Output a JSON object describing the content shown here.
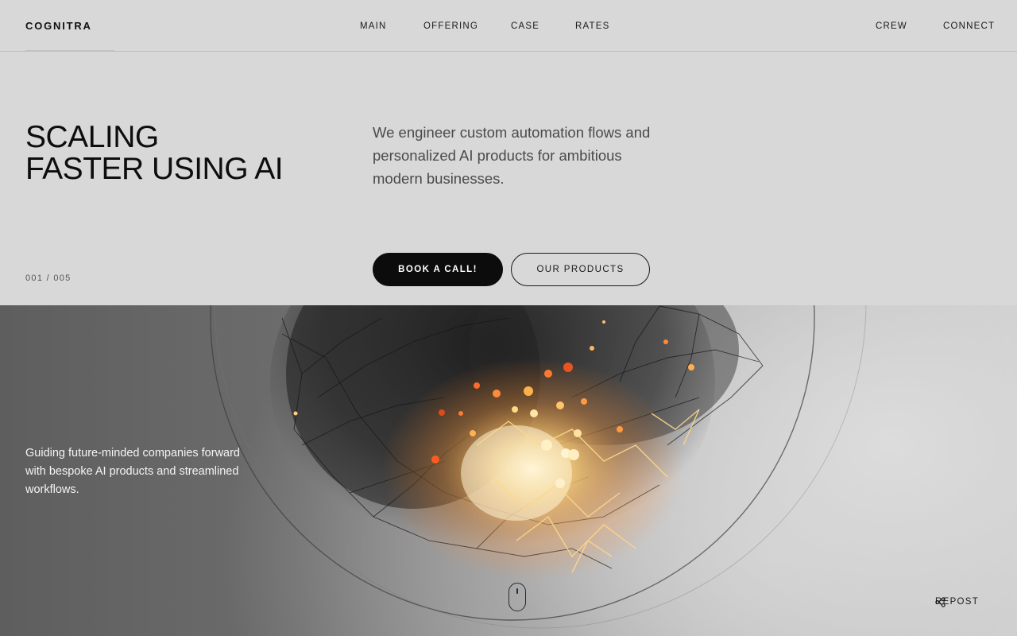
{
  "brand": {
    "name": "COGNITRA"
  },
  "nav": {
    "links": [
      {
        "label": "MAIN"
      },
      {
        "label": "OFFERING"
      },
      {
        "label": "CASE"
      },
      {
        "label": "RATES"
      },
      {
        "label": "CREW"
      },
      {
        "label": "CONNECT"
      }
    ]
  },
  "hero": {
    "headline_line1": "SCALING",
    "headline_line2": "FASTER USING AI",
    "intro": "We engineer custom automation flows and personalized AI products for ambitious modern businesses.",
    "counter": "001 / 005",
    "primary_button": "BOOK A CALL!",
    "secondary_button": "OUR PRODUCTS"
  },
  "visual": {
    "tagline": "Guiding future-minded companies forward with bespoke AI products and streamlined workflows.",
    "scroll_icon": "mouse-scroll-icon",
    "repost_label": "REPOST",
    "repost_icon": "share-icon"
  },
  "colors": {
    "page_background": "#d8d8d8",
    "text_primary": "#0d0d0d",
    "text_secondary": "#4a4a4a",
    "button_dark": "#0c0c0c",
    "glow": "#ffb347"
  }
}
